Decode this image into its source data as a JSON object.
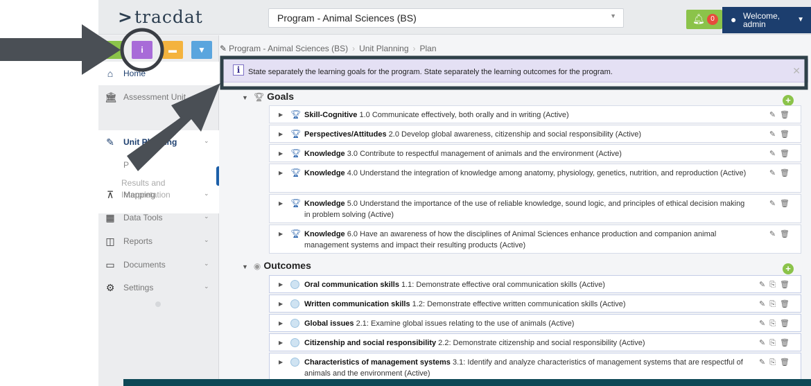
{
  "header": {
    "logo_chevron": ">",
    "logo_text": "tracdat",
    "program_select": "Program - Animal Sciences (BS)",
    "notification_count": "0",
    "user_label_line1": "Welcome,",
    "user_label_line2": "admin"
  },
  "toolbar": {
    "info_button": "i"
  },
  "sidebar": {
    "items": [
      {
        "label": "Home",
        "icon": "home-icon"
      },
      {
        "label": "Assessment Unit",
        "icon": "institution-icon"
      },
      {
        "label": "Unit Planning",
        "icon": "pencil-icon"
      },
      {
        "label": "Mapping",
        "icon": "sitemap-icon"
      },
      {
        "label": "Data Tools",
        "icon": "table-icon"
      },
      {
        "label": "Reports",
        "icon": "columns-icon"
      },
      {
        "label": "Documents",
        "icon": "folder-icon"
      },
      {
        "label": "Settings",
        "icon": "gear-icon"
      }
    ],
    "unit_planning_sub": {
      "plan_visible": "P",
      "results": "Results and Interpretation"
    }
  },
  "breadcrumb": {
    "items": [
      "Program - Animal Sciences (BS)",
      "Unit Planning",
      "Plan"
    ]
  },
  "info": {
    "icon": "i",
    "text": "State separately the learning goals for the program. State separately the learning outcomes for the program."
  },
  "goals": {
    "title": "Goals",
    "items": [
      {
        "name": "Skill-Cognitive",
        "text": "1.0 Communicate effectively, both orally and in writing (Active)"
      },
      {
        "name": "Perspectives/Attitudes",
        "text": "2.0 Develop global awareness, citizenship and social responsibility (Active)"
      },
      {
        "name": "Knowledge",
        "text": "3.0 Contribute to respectful management of animals and the environment (Active)"
      },
      {
        "name": "Knowledge",
        "text": "4.0 Understand the integration of knowledge among anatomy, physiology, genetics, nutrition, and reproduction (Active)"
      },
      {
        "name": "Knowledge",
        "text": "5.0 Understand the importance of the use of reliable knowledge, sound logic, and principles of ethical decision making in problem solving (Active)"
      },
      {
        "name": "Knowledge",
        "text": "6.0 Have an awareness of how the disciplines of Animal Sciences enhance production and companion animal management systems and impact their resulting products (Active)"
      }
    ]
  },
  "outcomes": {
    "title": "Outcomes",
    "items": [
      {
        "name": "Oral communication skills",
        "text": "1.1: Demonstrate effective oral communication skills (Active)"
      },
      {
        "name": "Written communication skills",
        "text": "1.2: Demonstrate effective written communication skills (Active)"
      },
      {
        "name": "Global issues",
        "text": "2.1: Examine global issues relating to the use of animals (Active)"
      },
      {
        "name": "Citizenship and social responsibility",
        "text": "2.2: Demonstrate citizenship and social responsibility (Active)"
      },
      {
        "name": "Characteristics of management systems",
        "text": "3.1: Identify and analyze characteristics of management systems that are respectful of animals and the environment (Active)"
      }
    ]
  },
  "colors": {
    "header_bg": "#e9ebed",
    "brand_navy": "#1c3e6e",
    "add_green": "#8bc34a",
    "info_purple": "#e4e0f4",
    "annotation_gray": "#4a4f55"
  }
}
